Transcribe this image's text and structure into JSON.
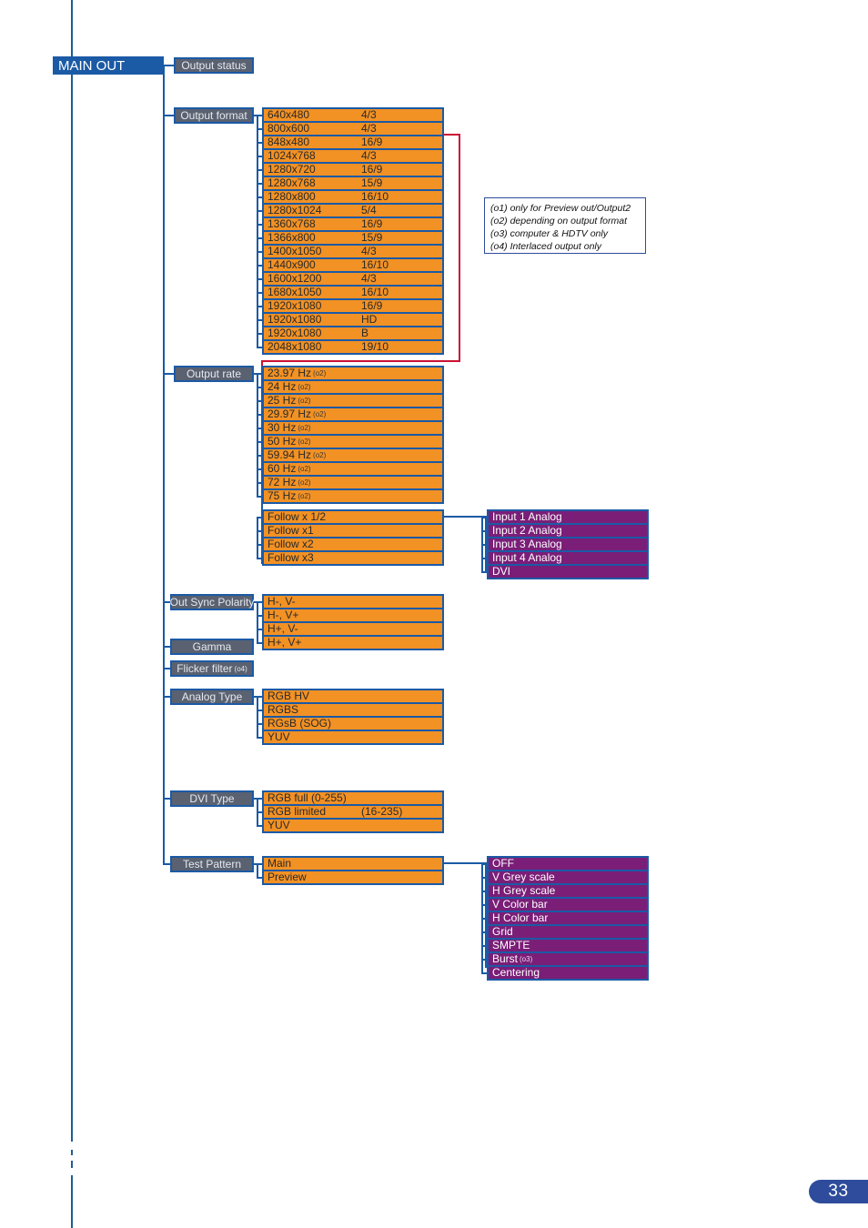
{
  "page": {
    "number": "33",
    "root_label": "MAIN OUT"
  },
  "categories": {
    "output_status": "Output status",
    "output_format": "Output format",
    "output_rate": "Output rate",
    "out_sync_polarity": "Out Sync Polarity",
    "gamma": "Gamma",
    "flicker_filter": "Flicker filter",
    "flicker_filter_note": "(o4)",
    "analog_type": "Analog Type",
    "dvi_type": "DVI Type",
    "test_pattern": "Test Pattern"
  },
  "output_format": [
    {
      "res": "640x480",
      "ratio": "4/3"
    },
    {
      "res": "800x600",
      "ratio": "4/3"
    },
    {
      "res": "848x480",
      "ratio": "16/9"
    },
    {
      "res": "1024x768",
      "ratio": "4/3"
    },
    {
      "res": "1280x720",
      "ratio": "16/9"
    },
    {
      "res": "1280x768",
      "ratio": "15/9"
    },
    {
      "res": "1280x800",
      "ratio": "16/10"
    },
    {
      "res": "1280x1024",
      "ratio": "5/4"
    },
    {
      "res": "1360x768",
      "ratio": "16/9"
    },
    {
      "res": "1366x800",
      "ratio": "15/9"
    },
    {
      "res": "1400x1050",
      "ratio": "4/3"
    },
    {
      "res": "1440x900",
      "ratio": "16/10"
    },
    {
      "res": "1600x1200",
      "ratio": "4/3"
    },
    {
      "res": "1680x1050",
      "ratio": "16/10"
    },
    {
      "res": "1920x1080",
      "ratio": "16/9"
    },
    {
      "res": "1920x1080",
      "ratio": "HD"
    },
    {
      "res": "1920x1080",
      "ratio": "B"
    },
    {
      "res": "2048x1080",
      "ratio": "19/10"
    }
  ],
  "output_rate": [
    {
      "label": "23.97 Hz",
      "note": "(o2)"
    },
    {
      "label": "24 Hz",
      "note": "(o2)"
    },
    {
      "label": "25 Hz",
      "note": "(o2)"
    },
    {
      "label": "29.97 Hz",
      "note": "(o2)"
    },
    {
      "label": "30 Hz",
      "note": "(o2)"
    },
    {
      "label": "50 Hz",
      "note": "(o2)"
    },
    {
      "label": "59.94 Hz",
      "note": "(o2)"
    },
    {
      "label": "60 Hz",
      "note": "(o2)"
    },
    {
      "label": "72 Hz",
      "note": "(o2)"
    },
    {
      "label": "75 Hz",
      "note": "(o2)"
    }
  ],
  "follow": [
    {
      "label": "Follow x 1/2"
    },
    {
      "label": "Follow x1"
    },
    {
      "label": "Follow x2"
    },
    {
      "label": "Follow x3"
    }
  ],
  "follow_sources": [
    {
      "label": "Input 1 Analog"
    },
    {
      "label": "Input 2 Analog"
    },
    {
      "label": "Input 3 Analog"
    },
    {
      "label": "Input 4 Analog"
    },
    {
      "label": "DVI"
    }
  ],
  "sync_polarity": [
    {
      "label": "H-, V-"
    },
    {
      "label": "H-, V+"
    },
    {
      "label": "H+, V-"
    },
    {
      "label": "H+, V+"
    }
  ],
  "analog_type": [
    {
      "label": "RGB HV"
    },
    {
      "label": "RGBS"
    },
    {
      "label": "RGsB (SOG)"
    },
    {
      "label": "YUV"
    }
  ],
  "dvi_type": [
    {
      "label": "RGB full (0-255)",
      "sep": ""
    },
    {
      "label": "RGB limited",
      "sep": "(16-235)"
    },
    {
      "label": "YUV",
      "sep": ""
    }
  ],
  "test_pattern_targets": [
    {
      "label": "Main"
    },
    {
      "label": "Preview"
    }
  ],
  "test_patterns": [
    {
      "label": "OFF",
      "note": ""
    },
    {
      "label": "V Grey scale",
      "note": ""
    },
    {
      "label": "H Grey scale",
      "note": ""
    },
    {
      "label": "V Color bar",
      "note": ""
    },
    {
      "label": "H Color bar",
      "note": ""
    },
    {
      "label": "Grid",
      "note": ""
    },
    {
      "label": "SMPTE",
      "note": ""
    },
    {
      "label": "Burst",
      "note": "(o3)"
    },
    {
      "label": "Centering",
      "note": ""
    }
  ],
  "notes": [
    "(o1) only for Preview out/Output2",
    "(o2) depending on output format",
    "(o3) computer & HDTV only",
    "(o4) Interlaced output only"
  ],
  "colors": {
    "root": "#1B5AA5",
    "category": "#5A6170",
    "value": "#F29124",
    "source": "#7A1E78",
    "connector": "#1B5AA5",
    "highlight": "#CC1133",
    "page_badge": "#2E4C9B"
  }
}
